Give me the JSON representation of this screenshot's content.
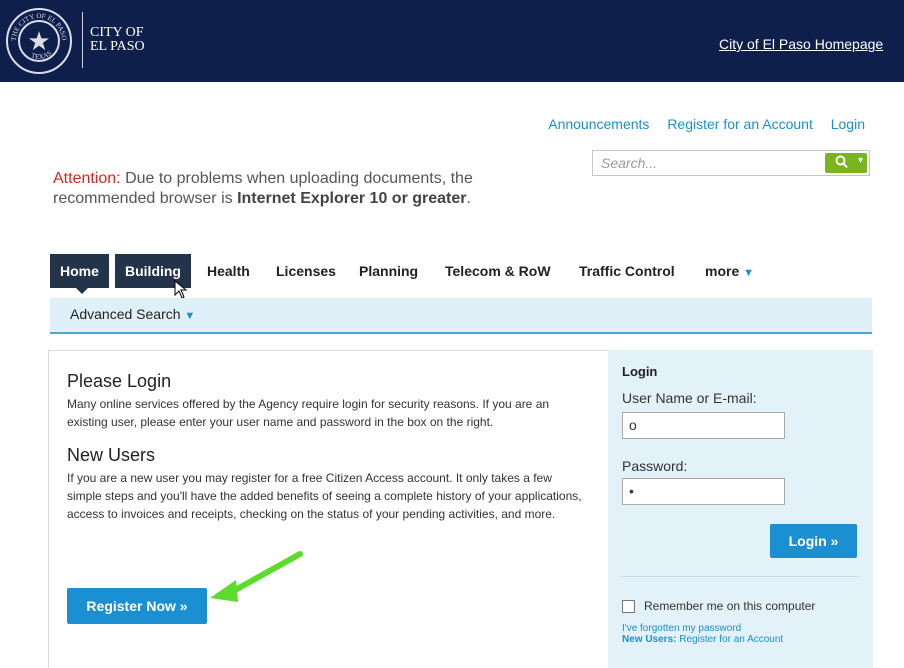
{
  "header": {
    "city_name": "CITY OF\nEL PASO",
    "seal_text_top": "THE CITY OF EL PASO",
    "seal_text_bottom": "TEXAS",
    "homepage_link": "City of El Paso Homepage"
  },
  "top_links": [
    "Announcements",
    "Register for an Account",
    "Login"
  ],
  "search": {
    "placeholder": "Search...",
    "icon": "search-icon"
  },
  "attention": {
    "label": "Attention:",
    "text_1": "Due to problems when uploading documents, the recommended browser is",
    "text_bold": "Internet Explorer 10 or greater",
    "text_2": "."
  },
  "nav": {
    "tabs": [
      "Home",
      "Building",
      "Health",
      "Licenses",
      "Planning",
      "Telecom & RoW",
      "Traffic Control",
      "more"
    ],
    "active": "Home",
    "sub_item": "Advanced Search"
  },
  "main": {
    "please_login_title": "Please Login",
    "please_login_text": "Many online services offered by the Agency require login for security reasons. If you are an existing user, please enter your user name and password in the box on the right.",
    "new_users_title": "New Users",
    "new_users_text": "If you are a new user you may register for a free Citizen Access account. It only takes a few simple steps and you'll have the added benefits of seeing a complete history of your applications, access to invoices and receipts, checking on the status of your pending activities, and more.",
    "register_button": "Register Now »"
  },
  "login_panel": {
    "title": "Login",
    "username_label": "User Name or E-mail:",
    "username_value": "o",
    "password_label": "Password:",
    "password_value": "•",
    "login_button": "Login »",
    "remember_label": "Remember me on this computer",
    "forgot_link": "I've forgotten my password",
    "new_users_label": "New Users:",
    "register_link": "Register for an Account"
  },
  "colors": {
    "header_bg": "#0f1f4b",
    "link": "#1a8fd1",
    "nav_active": "#23344a",
    "search_button": "#7ab51d",
    "annotation_arrow": "#5ddc2e"
  }
}
